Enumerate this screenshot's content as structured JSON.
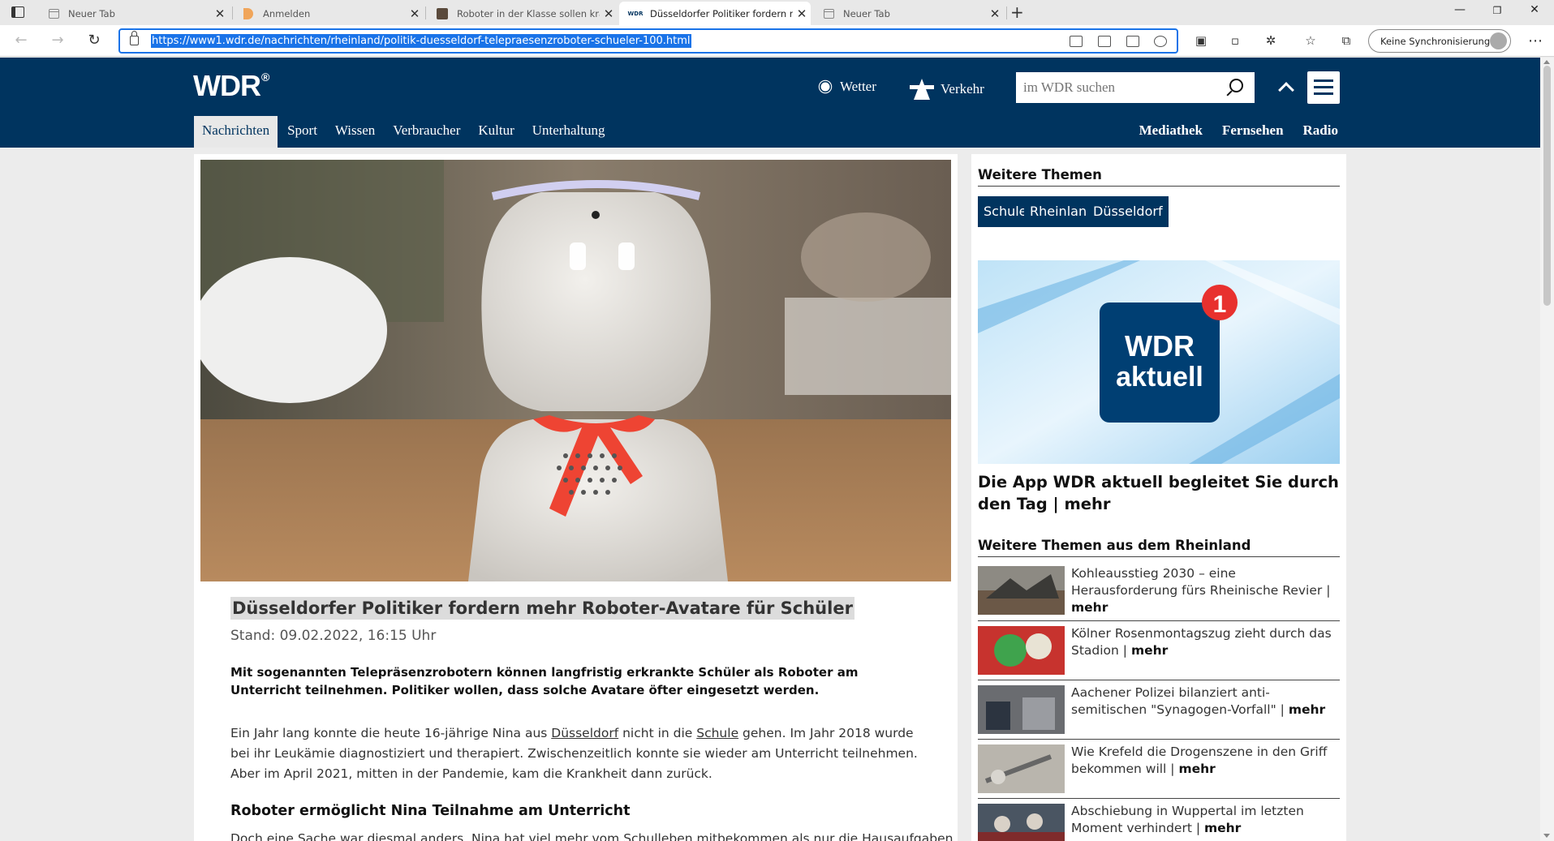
{
  "browser": {
    "tabs": [
      {
        "title": "Neuer Tab",
        "favicon": "page-icon"
      },
      {
        "title": "Anmelden",
        "favicon": "orange-icon"
      },
      {
        "title": "Roboter in der Klasse sollen kran",
        "favicon": "site-icon"
      },
      {
        "title": "Düsseldorfer Politiker fordern m",
        "favicon": "wdr-icon",
        "active": true
      },
      {
        "title": "Neuer Tab",
        "favicon": "page-icon"
      }
    ],
    "new_tab_label": "+",
    "url": "https://www1.wdr.de/nachrichten/rheinland/politik-duesseldorf-telepraesenzroboter-schueler-100.html",
    "sync_label": "Keine Synchronisierung"
  },
  "header": {
    "logo": "WDR",
    "weather_label": "Wetter",
    "traffic_label": "Verkehr",
    "search_placeholder": "im WDR suchen",
    "nav": [
      "Nachrichten",
      "Sport",
      "Wissen",
      "Verbraucher",
      "Kultur",
      "Unterhaltung"
    ],
    "side_nav": [
      "Mediathek",
      "Fernsehen",
      "Radio"
    ]
  },
  "article": {
    "title": "Düsseldorfer Politiker fordern mehr Roboter-Avatare für Schüler",
    "stand": "Stand: 09.02.2022, 16:15 Uhr",
    "teaser": "Mit sogenannten Telepräsenzrobotern können langfristig erkrankte Schüler als Roboter am Unterricht teilnehmen. Politiker wollen, dass solche Avatare öfter eingesetzt werden.",
    "p1_a": "Ein Jahr lang konnte die heute 16-jährige Nina aus ",
    "p1_link1": "Düsseldorf",
    "p1_b": " nicht in die ",
    "p1_link2": "Schule",
    "p1_c": " gehen. Im Jahr 2018 wurde bei ihr Leukämie diagnostiziert und therapiert. Zwischenzeitlich konnte sie wieder am Unterricht teilnehmen. Aber im April 2021, mitten in der Pandemie, kam die Krankheit dann zurück.",
    "subhead": "Roboter ermöglicht Nina Teilnahme am Unterricht",
    "p2_cut": "Doch eine Sache war diesmal anders. Nina hat viel mehr vom Schulleben mitbekommen als nur die Hausaufgaben."
  },
  "sidebar": {
    "topics_heading": "Weitere Themen",
    "tags": [
      "Schule",
      "Rheinland",
      "Düsseldorf"
    ],
    "promo_line1": "WDR",
    "promo_line2": "aktuell",
    "promo_badge": "1",
    "promo_title": "Die App WDR aktuell begleitet Sie durch den Tag | mehr",
    "more_heading": "Weitere Themen aus dem Rheinland",
    "teasers": [
      {
        "text": "Kohleausstieg 2030 – eine Herausforderung fürs Rheinische Revier | ",
        "mehr": "mehr"
      },
      {
        "text": "Kölner Rosenmontagszug zieht durch das Stadion | ",
        "mehr": "mehr"
      },
      {
        "text": "Aachener Polizei bilanziert anti-semitischen \"Synagogen-Vorfall\" | ",
        "mehr": "mehr"
      },
      {
        "text": "Wie Krefeld die Drogenszene in den Griff bekommen will | ",
        "mehr": "mehr"
      },
      {
        "text": "Abschiebung in Wuppertal im letzten Moment verhindert | ",
        "mehr": "mehr"
      }
    ]
  },
  "colors": {
    "wdr_blue": "#00345f",
    "url_highlight": "#1a73e8"
  }
}
